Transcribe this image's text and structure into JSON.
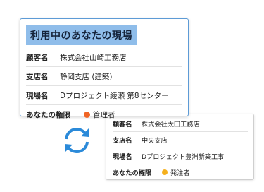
{
  "main_card": {
    "title": "利用中のあなたの現場",
    "rows": [
      {
        "label": "顧客名",
        "value": "株式会社山崎工務店"
      },
      {
        "label": "支店名",
        "value": "静岡支店 (建築)"
      },
      {
        "label": "現場名",
        "value": "Dプロジェクト綾瀬 第8センター"
      }
    ],
    "permission": {
      "label": "あなたの権限",
      "value": "管理者",
      "dot_color": "#f06424"
    }
  },
  "back_card": {
    "rows": [
      {
        "label": "顧客名",
        "value": "株式会社太田工務店"
      },
      {
        "label": "支店名",
        "value": "中央支店"
      },
      {
        "label": "現場名",
        "value": "Dプロジェクト豊洲新築工事"
      }
    ],
    "permission": {
      "label": "あなたの権限",
      "value": "発注者",
      "dot_color": "#f5b01d"
    }
  },
  "icons": {
    "sync": "sync-arrows-icon",
    "sync_color": "#2b8ad9"
  }
}
